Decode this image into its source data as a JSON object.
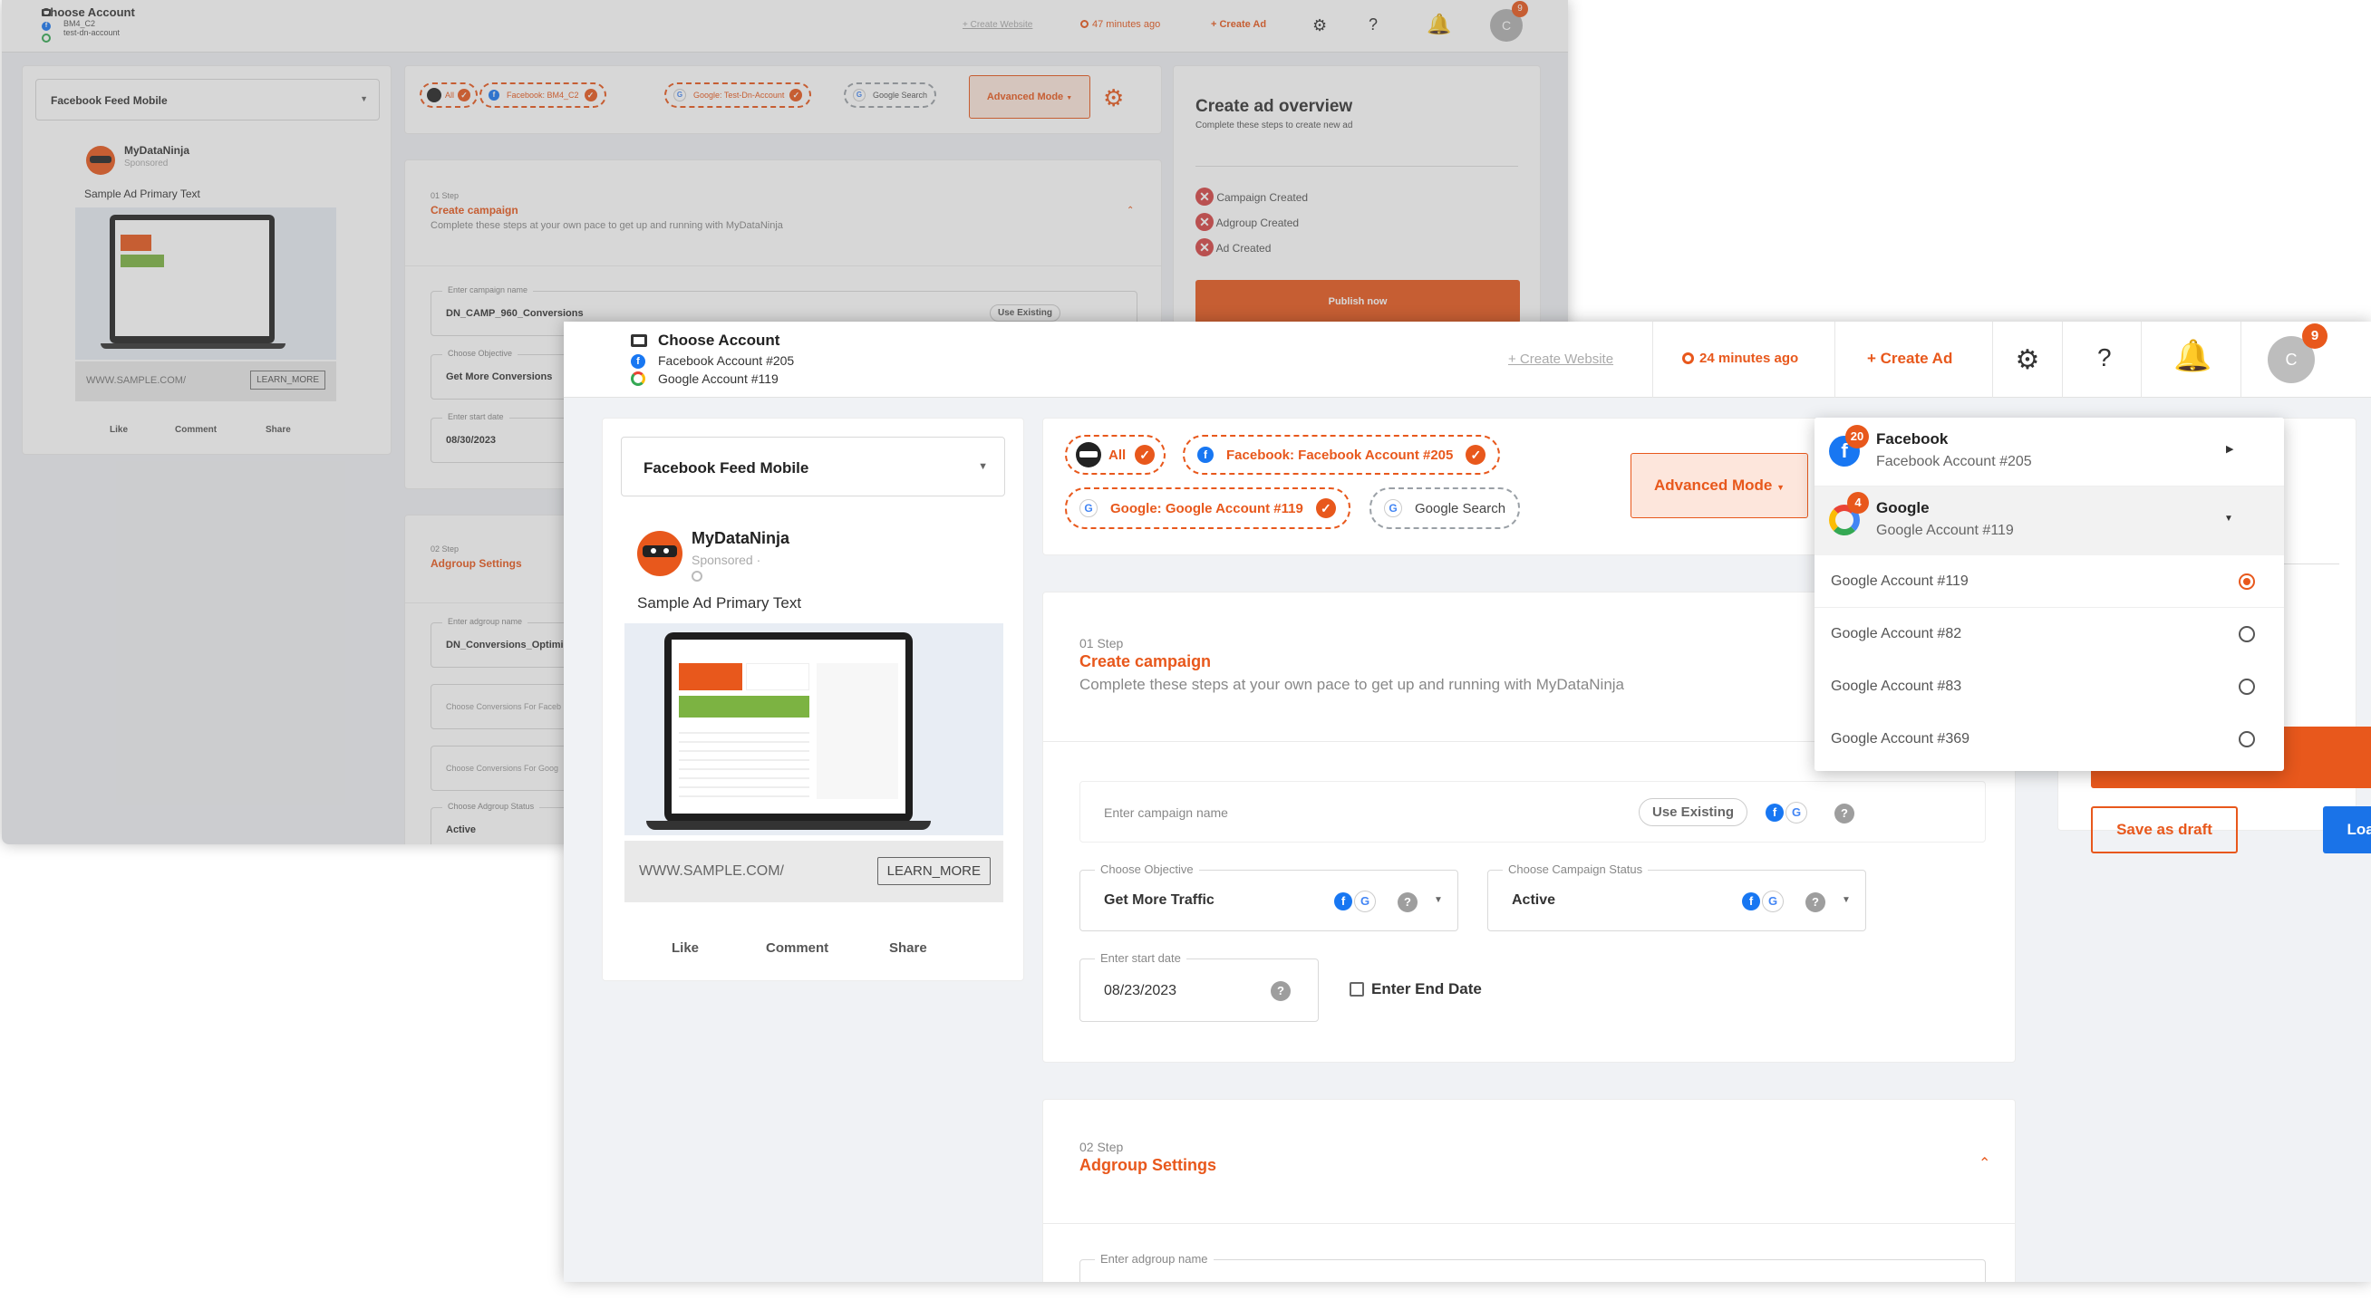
{
  "back": {
    "header": {
      "choose_account": "Choose Account",
      "fb_account": "BM4_C2",
      "google_account": "test-dn-account",
      "create_website": "+ Create Website",
      "last_saved": "47 minutes ago",
      "create_ad": "+ Create Ad",
      "help": "?",
      "notif_count": "9",
      "avatar": "C"
    },
    "placement": "Facebook Feed Mobile",
    "preview": {
      "name": "MyDataNinja",
      "sponsored": "Sponsored",
      "primary_text": "Sample Ad Primary Text",
      "url": "WWW.SAMPLE.COM/",
      "learn_more": "LEARN_MORE",
      "like": "Like",
      "comment": "Comment",
      "share": "Share"
    },
    "chips": {
      "all": "All",
      "facebook": "Facebook: BM4_C2",
      "google": "Google: Test-Dn-Account",
      "google_search": "Google Search"
    },
    "advanced_mode": "Advanced Mode",
    "step1": {
      "step": "01 Step",
      "title": "Create campaign",
      "desc": "Complete these steps at your own pace to get up and running with MyDataNinja",
      "campaign_label": "Enter campaign name",
      "campaign_value": "DN_CAMP_960_Conversions",
      "use_existing": "Use Existing",
      "objective_label": "Choose Objective",
      "objective_value": "Get More Conversions",
      "date_label": "Enter start date",
      "date_value": "08/30/2023"
    },
    "step2": {
      "step": "02 Step",
      "title": "Adgroup Settings",
      "adgroup_label": "Enter adgroup name",
      "adgroup_value": "DN_Conversions_Optimi",
      "conv_fb": "Choose Conversions For Faceb",
      "conv_google": "Choose Conversions For Goog",
      "status_label": "Choose Adgroup Status",
      "status_value": "Active"
    },
    "overview": {
      "title": "Create ad overview",
      "subtitle": "Complete these steps to create new ad",
      "items": [
        "Campaign Created",
        "Adgroup Created",
        "Ad Created"
      ],
      "publish": "Publish now"
    }
  },
  "front": {
    "header": {
      "choose_account": "Choose Account",
      "fb_account": "Facebook Account #205",
      "google_account": "Google Account #119",
      "create_website": "+ Create Website",
      "last_saved": "24 minutes ago",
      "create_ad": "+ Create Ad",
      "help": "?",
      "notif_count": "9",
      "avatar": "C"
    },
    "placement": "Facebook Feed Mobile",
    "preview": {
      "name": "MyDataNinja",
      "sponsored": "Sponsored ·",
      "primary_text": "Sample Ad Primary Text",
      "url": "WWW.SAMPLE.COM/",
      "learn_more": "LEARN_MORE",
      "like": "Like",
      "comment": "Comment",
      "share": "Share"
    },
    "chips": {
      "all": "All",
      "facebook": "Facebook: Facebook Account #205",
      "google": "Google: Google Account #119",
      "google_search": "Google Search"
    },
    "advanced_mode": "Advanced Mode",
    "step1": {
      "step": "01 Step",
      "title": "Create campaign",
      "desc": "Complete these steps at your own pace to get up and running with MyDataNinja",
      "campaign_placeholder": "Enter campaign name",
      "use_existing": "Use Existing",
      "objective_label": "Choose Objective",
      "objective_value": "Get More Traffic",
      "status_label": "Choose Campaign Status",
      "status_value": "Active",
      "date_label": "Enter start date",
      "date_value": "08/23/2023",
      "end_date": "Enter End Date"
    },
    "step2": {
      "step": "02 Step",
      "title": "Adgroup Settings",
      "adgroup_label": "Enter adgroup name"
    },
    "actions": {
      "save_draft": "Save as draft",
      "load_draft": "Load Draft"
    },
    "account_dropdown": {
      "facebook": {
        "name": "Facebook",
        "account": "Facebook Account #205",
        "badge": "20"
      },
      "google": {
        "name": "Google",
        "account": "Google Account #119",
        "badge": "4"
      },
      "options": [
        "Google Account #119",
        "Google Account #82",
        "Google Account #83",
        "Google Account #369"
      ],
      "selected": "Google Account #119"
    }
  },
  "colors": {
    "accent": "#e8581c",
    "blue": "#1a73e8",
    "facebook": "#1877f2"
  }
}
